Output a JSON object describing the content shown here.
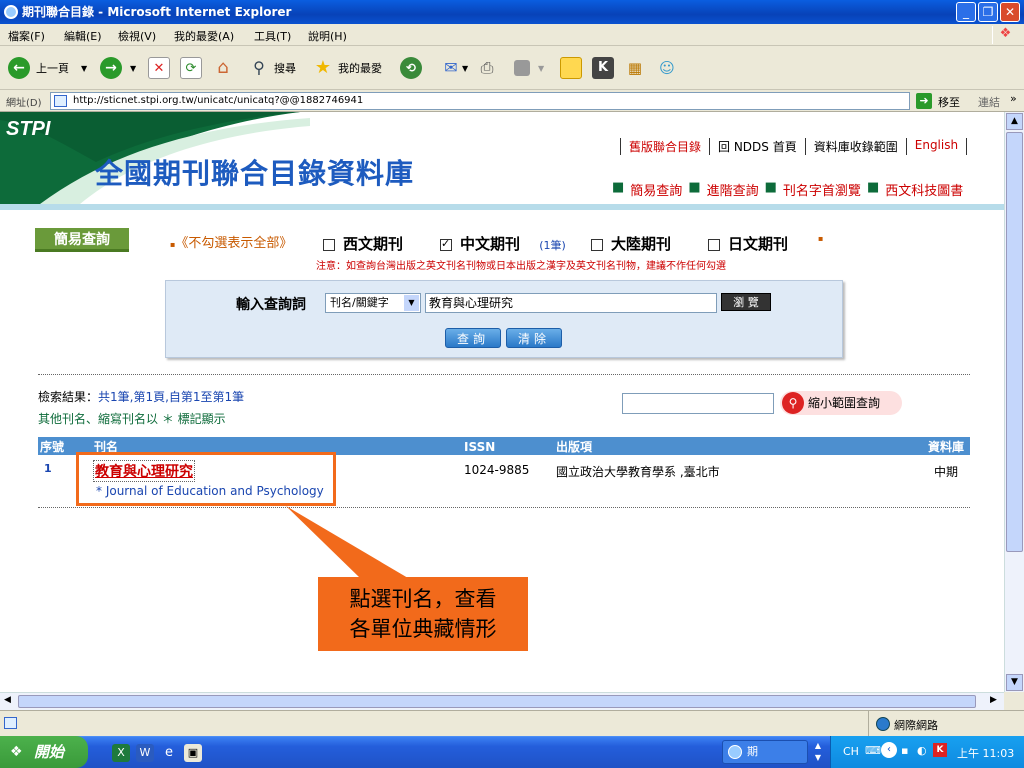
{
  "window": {
    "title": "期刊聯合目錄 - Microsoft Internet Explorer"
  },
  "menu": [
    "檔案(F)",
    "編輯(E)",
    "檢視(V)",
    "我的最愛(A)",
    "工具(T)",
    "說明(H)"
  ],
  "toolbar": {
    "back": "上一頁",
    "search": "搜尋",
    "favorites": "我的最愛"
  },
  "address": {
    "label": "網址(D)",
    "url": "http://sticnet.stpi.org.tw/unicatc/unicatq?@@1882746941",
    "go": "移至",
    "links": "連結"
  },
  "site": {
    "logo": "STPI",
    "title": "全國期刊聯合目錄資料庫",
    "toplinks": [
      "舊版聯合目錄",
      "回 NDDS 首頁",
      "資料庫收錄範圍",
      "English"
    ],
    "navlinks": [
      "簡易查詢",
      "進階查詢",
      "刊名字首瀏覽",
      "西文科技圖書"
    ]
  },
  "search": {
    "tab": "簡易查詢",
    "nocheck": "《不勾選表示全部》",
    "options": [
      {
        "label": "西文期刊",
        "checked": false,
        "count": ""
      },
      {
        "label": "中文期刊",
        "checked": true,
        "count": "(1筆)"
      },
      {
        "label": "大陸期刊",
        "checked": false,
        "count": ""
      },
      {
        "label": "日文期刊",
        "checked": false,
        "count": ""
      }
    ],
    "notice": "注意：如查詢台灣出版之英文刊名刊物或日本出版之漢字及英文刊名刊物，建議不作任何勾選",
    "label": "輸入查詢詞",
    "type": "刊名/關鍵字",
    "query": "教育與心理研究",
    "browse": "瀏 覽",
    "submit": "查詢",
    "clear": "清除"
  },
  "results": {
    "summary_label": "檢索結果：",
    "summary": "共1筆,第1頁,自第1至第1筆",
    "other": "其他刊名、縮寫刊名以 ＊ 標記顯示",
    "narrow": "縮小範圍查詢",
    "headers": [
      "序號",
      "刊名",
      "ISSN",
      "出版項",
      "資料庫"
    ],
    "rows": [
      {
        "no": "1",
        "title": "教育與心理研究",
        "alt": "* Journal of Education and Psychology",
        "issn": "1024-9885",
        "publisher": "國立政治大學教育學系 ,臺北市",
        "db": "中期"
      }
    ]
  },
  "callout": {
    "line1": "點選刊名，查看",
    "line2": "各單位典藏情形"
  },
  "statusbar": {
    "zone": "網際網路"
  },
  "taskbar": {
    "start": "開始",
    "task": "期",
    "lang": "CH",
    "clock": "上午 11:03"
  },
  "colors": {
    "accent_red": "#cc0000",
    "header_blue": "#4d8fcf",
    "callout_orange": "#f26a1b",
    "site_green": "#0d6b3a"
  }
}
